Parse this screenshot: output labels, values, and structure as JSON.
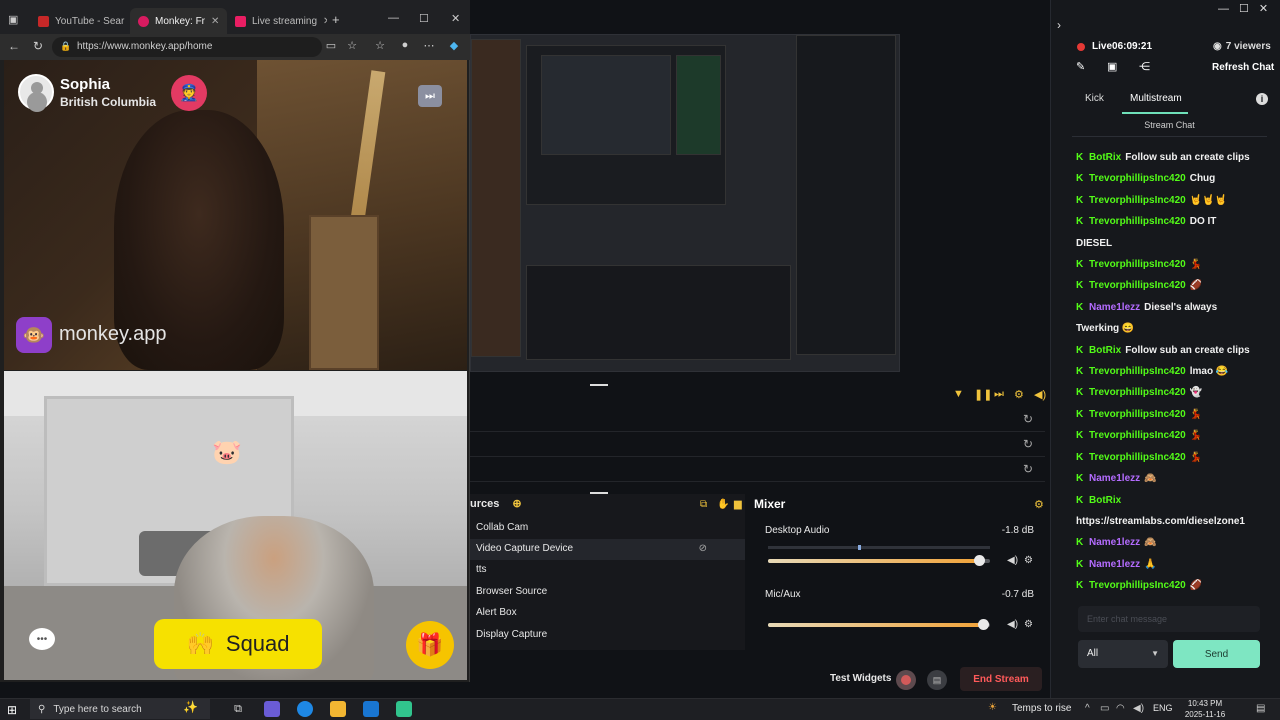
{
  "browser": {
    "tabs": [
      {
        "label": "YouTube - Sear",
        "color": "#c62828"
      },
      {
        "label": "Monkey: Fr",
        "color": "#d81b60"
      },
      {
        "label": "Live streaming",
        "color": "#e91e63"
      }
    ],
    "url": "https://www.monkey.app/home",
    "caller": {
      "name": "Sophia",
      "location": "British Columbia"
    },
    "brand": "monkey.app",
    "squad_label": "Squad"
  },
  "studio": {
    "sources_title": "urces",
    "sources": [
      "Collab Cam",
      "Video Capture Device",
      "tts",
      "Browser Source",
      "Alert Box",
      "Display Capture"
    ],
    "selected_source": 1,
    "mixer_title": "Mixer",
    "mixer": [
      {
        "label": "Desktop Audio",
        "db": "-1.8 dB",
        "level": 0.95
      },
      {
        "label": "Mic/Aux",
        "db": "-0.7 dB",
        "level": 0.97
      }
    ],
    "test_widgets": "Test Widgets",
    "end_stream": "End Stream"
  },
  "chat": {
    "live_label": "Live",
    "live_time": "06:09:21",
    "viewers": "7 viewers",
    "refresh": "Refresh Chat",
    "tabs": [
      "Kick",
      "Multistream"
    ],
    "title": "Stream Chat",
    "messages": [
      {
        "user": "BotRix",
        "text": "Follow sub an create clips",
        "color": "#53fc18",
        "badge": true
      },
      {
        "user": "TrevorphillipsInc420",
        "text": "Chug",
        "color": "#53fc18",
        "badge": true
      },
      {
        "user": "TrevorphillipsInc420",
        "text": "🤘🤘🤘",
        "color": "#53fc18",
        "badge": true
      },
      {
        "user": "TrevorphillipsInc420",
        "text": "DO IT",
        "color": "#53fc18",
        "badge": true
      },
      {
        "user": "",
        "text": "DIESEL",
        "color": "#f1f1f1",
        "badge": false
      },
      {
        "user": "TrevorphillipsInc420",
        "text": "💃",
        "color": "#53fc18",
        "badge": true
      },
      {
        "user": "TrevorphillipsInc420",
        "text": "🏈",
        "color": "#53fc18",
        "badge": true
      },
      {
        "user": "Name1lezz",
        "text": "Diesel's always",
        "color": "#b46cff",
        "badge": true
      },
      {
        "user": "",
        "text": "Twerking 😄",
        "color": "#f1f1f1",
        "badge": false
      },
      {
        "user": "BotRix",
        "text": "Follow sub an create clips",
        "color": "#53fc18",
        "badge": true
      },
      {
        "user": "TrevorphillipsInc420",
        "text": "lmao 😂",
        "color": "#53fc18",
        "badge": true
      },
      {
        "user": "TrevorphillipsInc420",
        "text": "👻",
        "color": "#53fc18",
        "badge": true
      },
      {
        "user": "TrevorphillipsInc420",
        "text": "💃",
        "color": "#53fc18",
        "badge": true
      },
      {
        "user": "TrevorphillipsInc420",
        "text": "💃",
        "color": "#53fc18",
        "badge": true
      },
      {
        "user": "TrevorphillipsInc420",
        "text": "💃",
        "color": "#53fc18",
        "badge": true
      },
      {
        "user": "Name1lezz",
        "text": "🙈",
        "color": "#b46cff",
        "badge": true
      },
      {
        "user": "BotRix",
        "text": "",
        "color": "#53fc18",
        "badge": true
      },
      {
        "user": "",
        "text": "https://streamlabs.com/dieselzone1",
        "color": "#f1f1f1",
        "badge": false
      },
      {
        "user": "Name1lezz",
        "text": "🙈",
        "color": "#b46cff",
        "badge": true
      },
      {
        "user": "Name1lezz",
        "text": "🙏",
        "color": "#b46cff",
        "badge": true
      },
      {
        "user": "TrevorphillipsInc420",
        "text": "🏈",
        "color": "#53fc18",
        "badge": true
      }
    ],
    "input_placeholder": "Enter chat message",
    "filter": "All",
    "send": "Send"
  },
  "taskbar": {
    "search_placeholder": "Type here to search",
    "weather": "Temps to rise",
    "lang": "ENG",
    "time": "10:43 PM",
    "date": "2025-11-16"
  }
}
